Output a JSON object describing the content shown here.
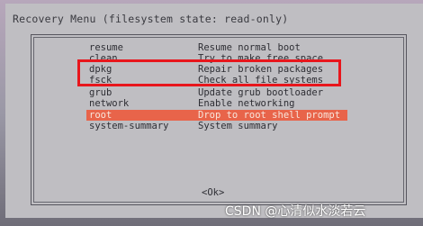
{
  "title": "Recovery Menu (filesystem state: read-only)",
  "menu": {
    "items": [
      {
        "key": "resume",
        "desc": "Resume normal boot"
      },
      {
        "key": "clean",
        "desc": "Try to make free space"
      },
      {
        "key": "dpkg",
        "desc": "Repair broken packages"
      },
      {
        "key": "fsck",
        "desc": "Check all file systems"
      },
      {
        "key": "grub",
        "desc": "Update grub bootloader"
      },
      {
        "key": "network",
        "desc": "Enable networking"
      },
      {
        "key": "root",
        "desc": "Drop to root shell prompt"
      },
      {
        "key": "system-summary",
        "desc": "System summary"
      }
    ],
    "selected_index": 6
  },
  "ok_label": "<Ok>",
  "watermark": "CSDN @心清似水淡若云",
  "colors": {
    "selection": "#e8644a",
    "annotation_box": "#e8161c"
  }
}
